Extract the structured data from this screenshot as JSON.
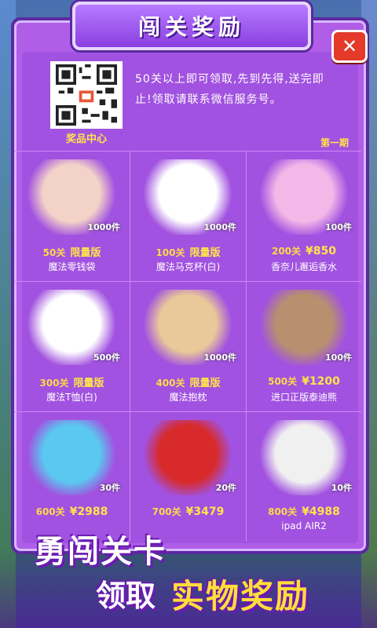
{
  "header": {
    "title": "闯关奖励",
    "close_icon": "close-icon"
  },
  "info": {
    "text": "50关以上即可领取,先到先得,送完即止!领取请联系微信服务号。",
    "qr_label": "奖品中心",
    "issue": "第一期"
  },
  "colors": {
    "panel": "#b05ee8",
    "border": "#5a2aa0",
    "accent": "#ffe54a",
    "close": "#e33a2a"
  },
  "prizes": [
    {
      "level": "50关",
      "tag": "限量版",
      "name": "魔法零钱袋",
      "qty": "1000件",
      "icon": "coin-purse-image",
      "color": "#f3d2c8"
    },
    {
      "level": "100关",
      "tag": "限量版",
      "name": "魔法马克杯(白)",
      "qty": "1000件",
      "icon": "mug-image",
      "color": "#ffffff"
    },
    {
      "level": "200关",
      "tag": "¥850",
      "name": "香奈儿邂逅香水",
      "qty": "100件",
      "icon": "perfume-image",
      "color": "#f4b8e8"
    },
    {
      "level": "300关",
      "tag": "限量版",
      "name": "魔法T恤(白)",
      "qty": "500件",
      "icon": "tshirt-image",
      "color": "#ffffff"
    },
    {
      "level": "400关",
      "tag": "限量版",
      "name": "魔法抱枕",
      "qty": "1000件",
      "icon": "pillow-image",
      "color": "#e9c89a"
    },
    {
      "level": "500关",
      "tag": "¥1200",
      "name": "进口正版泰迪熊",
      "qty": "100件",
      "icon": "teddy-bear-image",
      "color": "#b89070"
    },
    {
      "level": "600关",
      "tag": "¥2988",
      "name": "",
      "qty": "30件",
      "icon": "smartwatch-image",
      "color": "#5ac8f0"
    },
    {
      "level": "700关",
      "tag": "¥3479",
      "name": "",
      "qty": "20件",
      "icon": "headphones-image",
      "color": "#d82a2a"
    },
    {
      "level": "800关",
      "tag": "¥4988",
      "name": "ipad AIR2",
      "qty": "10件",
      "icon": "tablet-image",
      "color": "#f0f0f0"
    }
  ],
  "slogan": {
    "line1": "勇闯关卡",
    "line2a": "领取",
    "line2b": "实物奖励"
  }
}
